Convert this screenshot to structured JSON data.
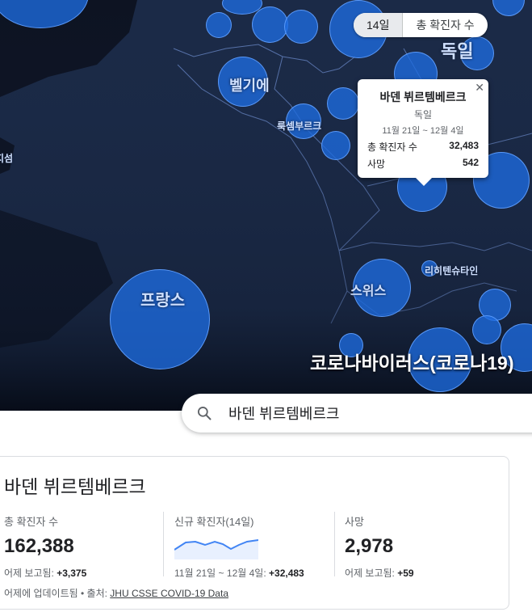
{
  "map": {
    "labels": {
      "germany": "독일",
      "belgium": "벨기에",
      "luxembourg": "룩셈부르크",
      "france": "프랑스",
      "switzerland": "스위스",
      "liechtenstein": "리히텐슈타인",
      "netherlands_partial": "지섬"
    },
    "title": "코로나바이러스(코로나19)"
  },
  "toggle": {
    "days": "14일",
    "total": "총 확진자 수"
  },
  "popup": {
    "region": "바덴 뷔르템베르크",
    "country": "독일",
    "dates": "11월 21일 ~ 12월 4일",
    "total_label": "총 확진자 수",
    "total_value": "32,483",
    "deaths_label": "사망",
    "deaths_value": "542"
  },
  "search": {
    "value": "바덴 뷔르템베르크"
  },
  "card": {
    "region": "바덴 뷔르템베르크",
    "total": {
      "label": "총 확진자 수",
      "value": "162,388",
      "delta_label": "어제 보고됨:",
      "delta_value": "+3,375"
    },
    "new_cases": {
      "label": "신규 확진자(14일)",
      "delta_label": "11월 21일 ~ 12월 4일:",
      "delta_value": "+32,483"
    },
    "deaths": {
      "label": "사망",
      "value": "2,978",
      "delta_label": "어제 보고됨:",
      "delta_value": "+59"
    },
    "footer_text": "어제에 업데이트됨 • 출처: ",
    "source_link": "JHU CSSE COVID-19 Data"
  },
  "colors": {
    "map_bg": "#1b2a47",
    "bubble": "#1e6ce0",
    "card_border": "#dadce0"
  },
  "icons": {
    "search": "search-icon",
    "close": "close-icon"
  }
}
